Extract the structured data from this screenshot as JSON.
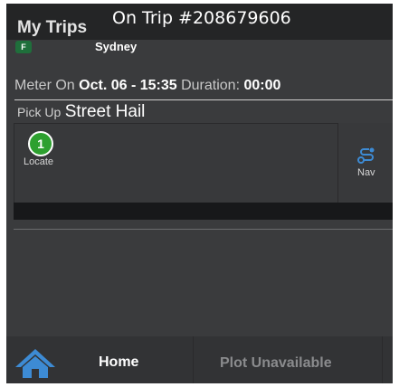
{
  "header": {
    "app_title": "My Trips",
    "trip_title": "On Trip #208679606"
  },
  "trip": {
    "badge": "F",
    "city": "Sydney",
    "meter_label": "Meter On",
    "meter_value": "Oct. 06 - 15:35",
    "duration_label": "Duration:",
    "duration_value": "00:00",
    "pickup_label": "Pick Up",
    "pickup_value": "Street Hail"
  },
  "actions": {
    "locate_count": "1",
    "locate_label": "Locate",
    "nav_label": "Nav"
  },
  "bottom_nav": {
    "home_label": "Home",
    "plot_label": "Plot Unavailable"
  },
  "colors": {
    "accent_green": "#2da02f",
    "nav_blue": "#3d8bd4",
    "home_blue": "#3d8bd4"
  }
}
